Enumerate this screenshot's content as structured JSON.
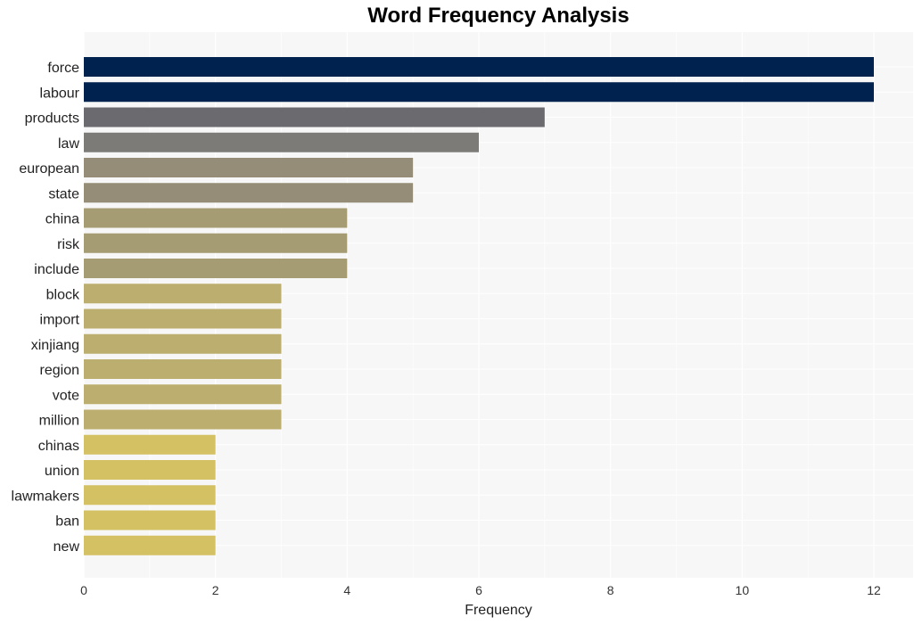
{
  "chart_data": {
    "type": "bar",
    "orientation": "horizontal",
    "title": "Word Frequency Analysis",
    "xlabel": "Frequency",
    "ylabel": "",
    "xlim": [
      0,
      12.6
    ],
    "xticks": [
      0,
      2,
      4,
      6,
      8,
      10,
      12
    ],
    "grid": true,
    "categories": [
      "force",
      "labour",
      "products",
      "law",
      "european",
      "state",
      "china",
      "risk",
      "include",
      "block",
      "import",
      "xinjiang",
      "region",
      "vote",
      "million",
      "chinas",
      "union",
      "lawmakers",
      "ban",
      "new"
    ],
    "values": [
      12,
      12,
      7,
      6,
      5,
      5,
      4,
      4,
      4,
      3,
      3,
      3,
      3,
      3,
      3,
      2,
      2,
      2,
      2,
      2
    ],
    "colors": {
      "12": "#00224e",
      "7": "#6b6b6f",
      "6": "#7c7b78",
      "5": "#958d77",
      "4": "#a59c74",
      "3": "#bcae6e",
      "2": "#d3c164"
    },
    "plot_background": "#f7f7f7",
    "grid_color": "#ffffff"
  }
}
